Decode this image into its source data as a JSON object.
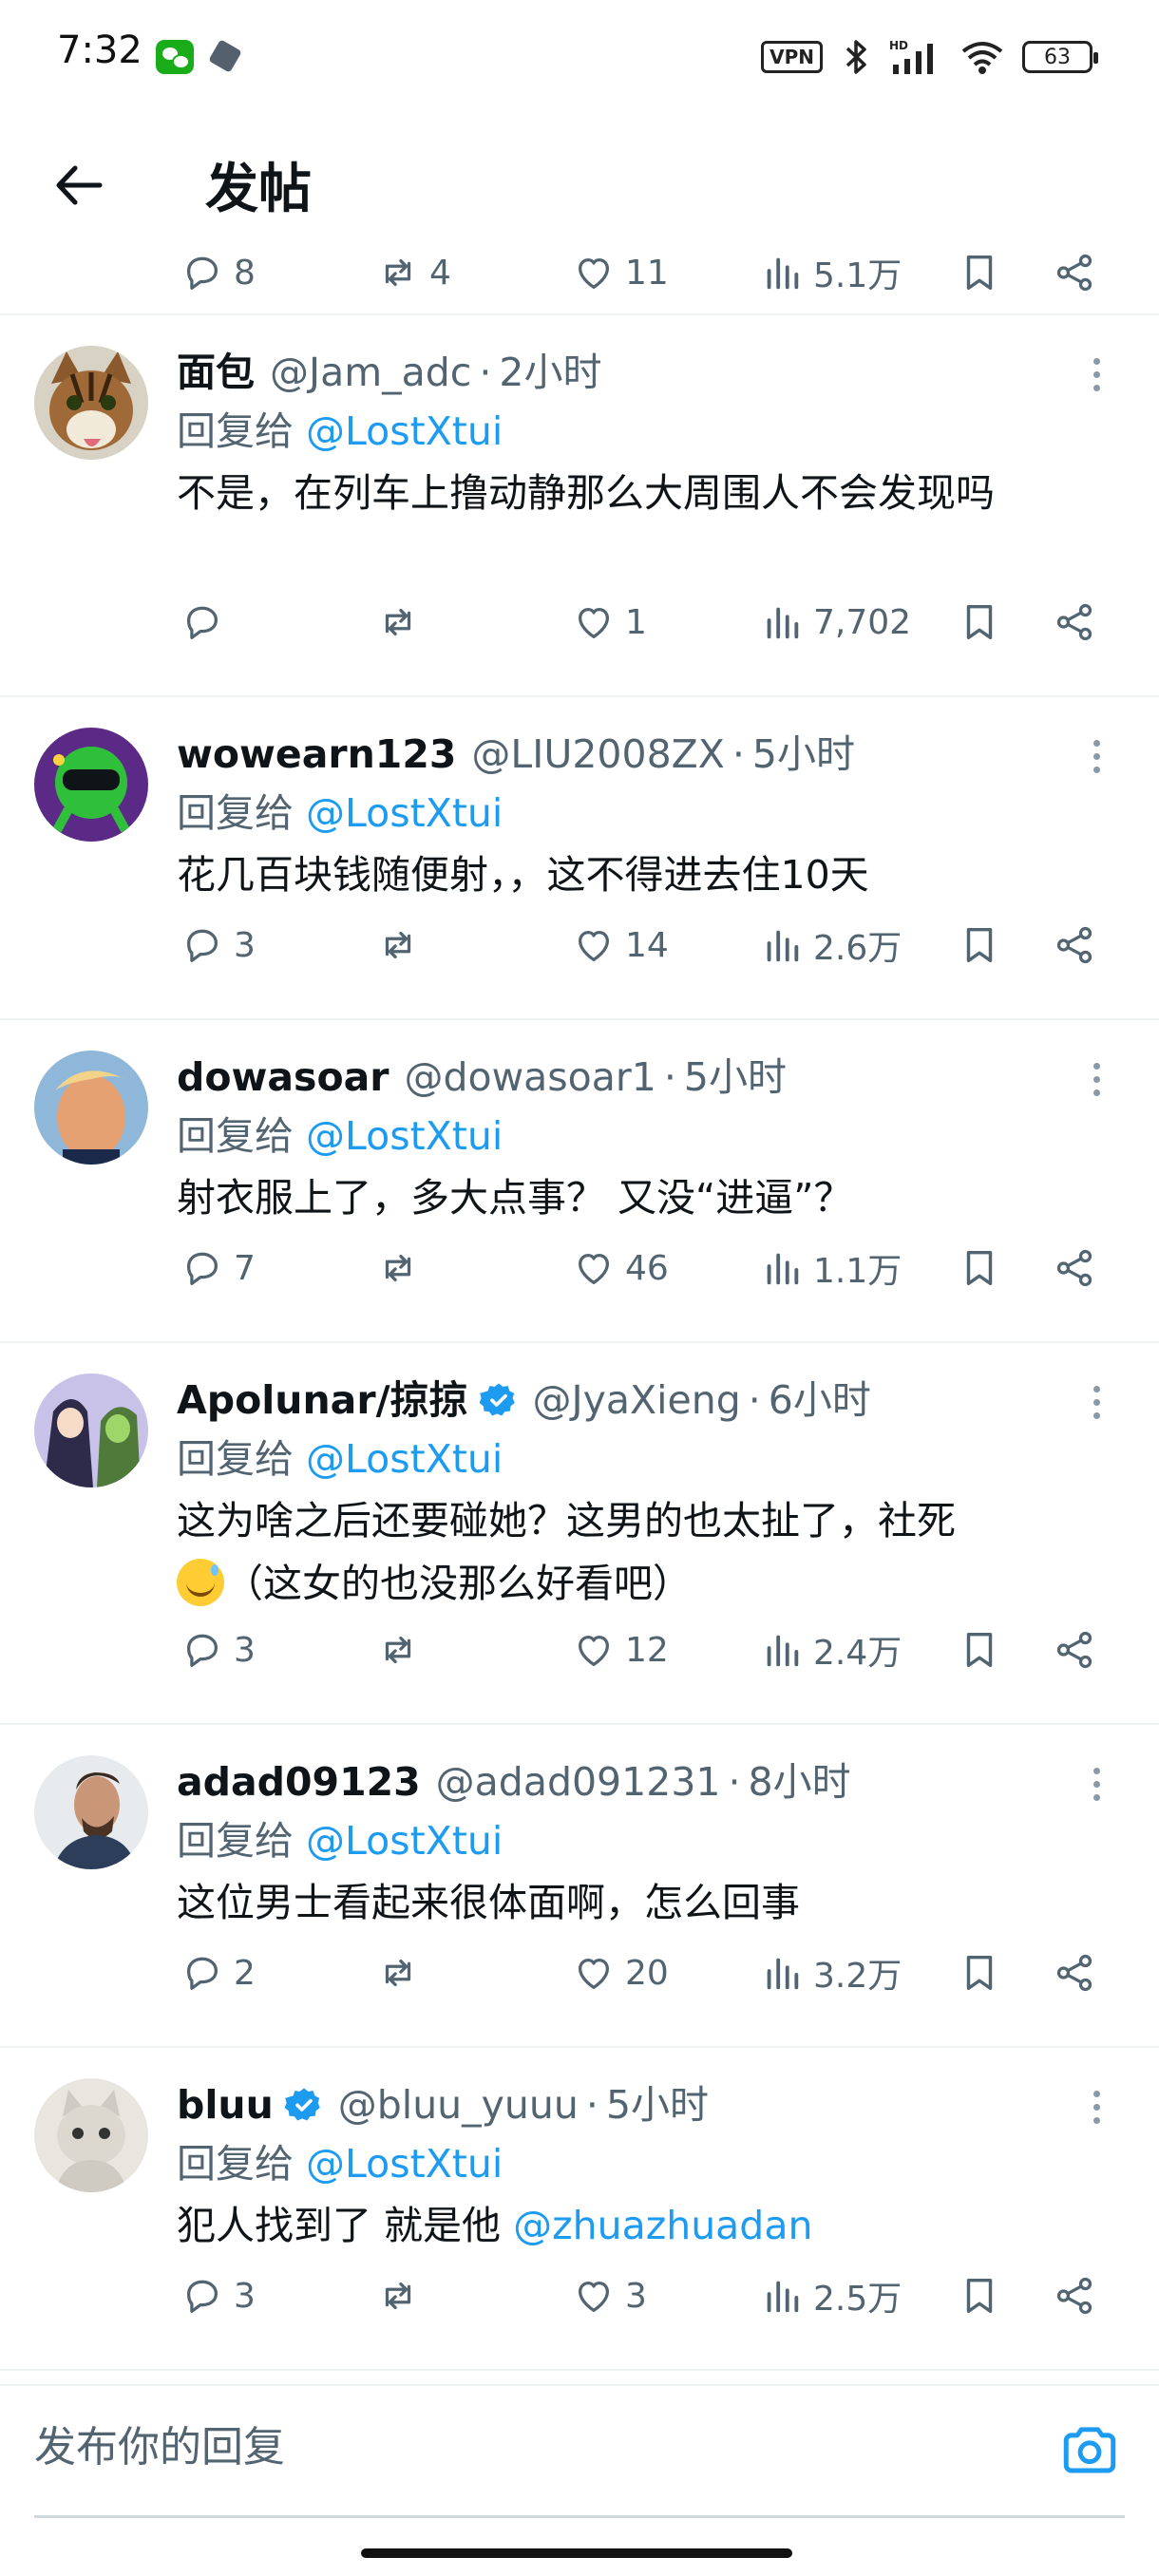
{
  "status_bar": {
    "time": "7:32",
    "vpn": "VPN",
    "signal_label": "HD",
    "battery": "63"
  },
  "header": {
    "title": "发帖"
  },
  "prev_post": {
    "replies": "8",
    "retweets": "4",
    "likes": "11",
    "views": "5.1万"
  },
  "replies": [
    {
      "name": "面包",
      "verified": false,
      "handle": "@Jam_adc",
      "time": "2小时",
      "reply_to_prefix": "回复给 ",
      "reply_to": "@LostXtui",
      "text": "不是，在列车上撸动静那么大周围人不会发现吗",
      "replies": "",
      "retweets": "",
      "likes": "1",
      "views": "7,702"
    },
    {
      "name": "wowearn123",
      "verified": false,
      "handle": "@LIU2008ZX",
      "time": "5小时",
      "reply_to_prefix": "回复给 ",
      "reply_to": "@LostXtui",
      "text": "花几百块钱随便射，，这不得进去住10天",
      "replies": "3",
      "retweets": "",
      "likes": "14",
      "views": "2.6万"
    },
    {
      "name": "dowasoar",
      "verified": false,
      "handle": "@dowasoar1",
      "time": "5小时",
      "reply_to_prefix": "回复给 ",
      "reply_to": "@LostXtui",
      "text": "射衣服上了，多大点事？ 又没“进逼”？",
      "replies": "7",
      "retweets": "",
      "likes": "46",
      "views": "1.1万"
    },
    {
      "name": "Apolunar/掠掠",
      "verified": true,
      "handle": "@JyaXieng",
      "time": "6小时",
      "reply_to_prefix": "回复给 ",
      "reply_to": "@LostXtui",
      "text_line1": "这为啥之后还要碰她？这男的也太扯了，社死",
      "text_line2": "（这女的也没那么好看吧）",
      "replies": "3",
      "retweets": "",
      "likes": "12",
      "views": "2.4万"
    },
    {
      "name": "adad09123",
      "verified": false,
      "handle": "@adad091231",
      "time": "8小时",
      "reply_to_prefix": "回复给 ",
      "reply_to": "@LostXtui",
      "text": "这位男士看起来很体面啊，怎么回事",
      "replies": "2",
      "retweets": "",
      "likes": "20",
      "views": "3.2万"
    },
    {
      "name": "bluu",
      "verified": true,
      "handle": "@bluu_yuuu",
      "time": "5小时",
      "reply_to_prefix": "回复给 ",
      "reply_to": "@LostXtui",
      "text": "犯人找到了 就是他 ",
      "mention": "@zhuazhuadan",
      "replies": "3",
      "retweets": "",
      "likes": "3",
      "views": "2.5万"
    }
  ],
  "compose": {
    "placeholder": "发布你的回复"
  },
  "colors": {
    "accent": "#1d9bf0",
    "text_secondary": "#536471",
    "divider": "#eff3f4"
  }
}
